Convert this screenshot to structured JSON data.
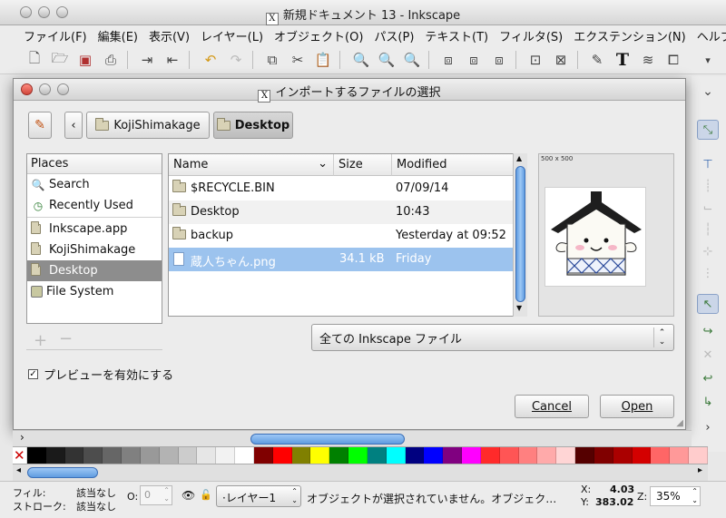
{
  "window": {
    "title": "新規ドキュメント 13 - Inkscape",
    "x_glyph": "X"
  },
  "menu": [
    "ファイル(F)",
    "編集(E)",
    "表示(V)",
    "レイヤー(L)",
    "オブジェクト(O)",
    "パス(P)",
    "テキスト(T)",
    "フィルタ(S)",
    "エクステンション(N)",
    "ヘルプ(H)"
  ],
  "dialog": {
    "title": "インポートするファイルの選択",
    "breadcrumb": [
      "KojiShimakage",
      "Desktop"
    ],
    "places_header": "Places",
    "places": [
      {
        "label": "Search",
        "icon": "search-icon"
      },
      {
        "label": "Recently Used",
        "icon": "clock-icon"
      },
      {
        "label": "Inkscape.app",
        "icon": "folder-icon"
      },
      {
        "label": "KojiShimakage",
        "icon": "folder-icon"
      },
      {
        "label": "Desktop",
        "icon": "folder-icon",
        "selected": true
      },
      {
        "label": "File System",
        "icon": "drive-icon"
      }
    ],
    "columns": {
      "name": "Name",
      "size": "Size",
      "modified": "Modified"
    },
    "files": [
      {
        "name": "$RECYCLE.BIN",
        "size": "",
        "modified": "07/09/14",
        "icon": "folder-icon"
      },
      {
        "name": "Desktop",
        "size": "",
        "modified": "10:43",
        "icon": "folder-icon"
      },
      {
        "name": "backup",
        "size": "",
        "modified": "Yesterday at 09:52",
        "icon": "folder-icon"
      },
      {
        "name": "蔵人ちゃん.png",
        "size": "34.1 kB",
        "modified": "Friday",
        "icon": "image-file-icon",
        "selected": true
      }
    ],
    "preview_size": "500 x 500",
    "filter": "全ての Inkscape ファイル",
    "enable_preview": "プレビューを有効にする",
    "cancel": "Cancel",
    "open": "Open"
  },
  "palette": [
    "#000000",
    "#1a1a1a",
    "#333333",
    "#4d4d4d",
    "#666666",
    "#808080",
    "#999999",
    "#b3b3b3",
    "#cccccc",
    "#e6e6e6",
    "#f2f2f2",
    "#ffffff",
    "#800000",
    "#ff0000",
    "#808000",
    "#ffff00",
    "#008000",
    "#00ff00",
    "#008080",
    "#00ffff",
    "#000080",
    "#0000ff",
    "#800080",
    "#ff00ff",
    "#ff2a2a",
    "#ff5555",
    "#ff8080",
    "#ffaaaa",
    "#ffd5d5",
    "#550000",
    "#800000",
    "#aa0000",
    "#d40000",
    "#ff6666",
    "#ff9999",
    "#ffcccc"
  ],
  "status": {
    "fill_label": "フィル:",
    "fill_value": "該当なし",
    "stroke_label": "ストローク:",
    "stroke_value": "該当なし",
    "opacity_label": "O:",
    "opacity_value": "0",
    "layer": "·レイヤー1",
    "message": "オブジェクトが選択されていません。オブジェク…",
    "x_label": "X:",
    "x_value": "4.03",
    "y_label": "Y:",
    "y_value": "383.02",
    "zoom_label": "Z:",
    "zoom_value": "35%"
  }
}
